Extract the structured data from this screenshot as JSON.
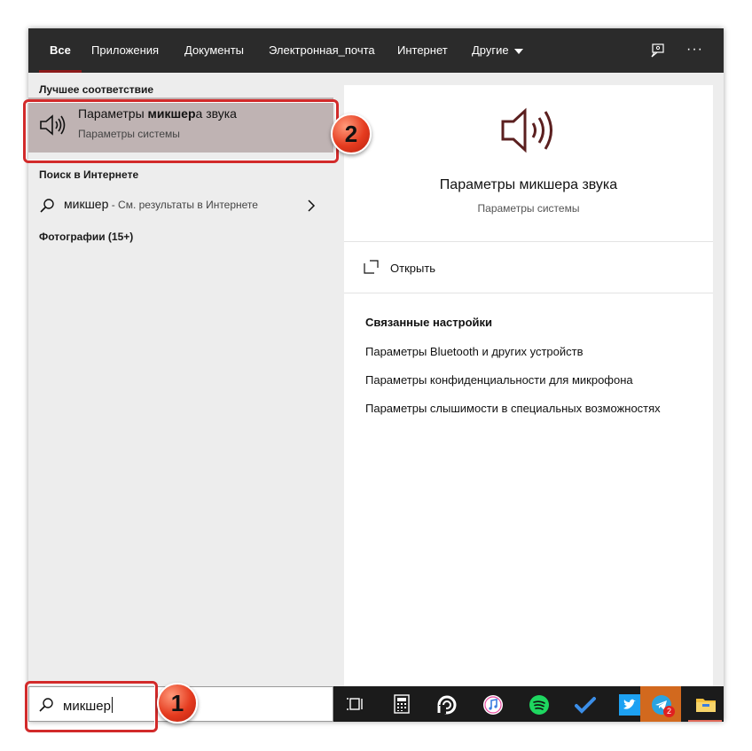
{
  "tabs": [
    {
      "label": "Все",
      "active": true
    },
    {
      "label": "Приложения"
    },
    {
      "label": "Документы"
    },
    {
      "label": "Электронная_почта"
    },
    {
      "label": "Интернет"
    },
    {
      "label": "Другие"
    }
  ],
  "top_icons": [
    "feedback-icon",
    "more-options-icon"
  ],
  "top_more": "···",
  "left": {
    "best_match_heading": "Лучшее соответствие",
    "best_match": {
      "title_prefix": "Параметры ",
      "title_bold": "микшер",
      "title_suffix": "а звука",
      "subtitle": "Параметры системы",
      "icon": "speaker-icon"
    },
    "web_heading": "Поиск в Интернете",
    "web_query": "микшер",
    "web_hint": " - См. результаты в Интернете",
    "photos_heading": "Фотографии (15+)"
  },
  "preview": {
    "icon": "speaker-icon",
    "title": "Параметры микшера звука",
    "subtitle": "Параметры системы",
    "open_label": "Открыть",
    "related_heading": "Связанные настройки",
    "related_links": [
      "Параметры Bluetooth и других устройств",
      "Параметры конфиденциальности для микрофона",
      "Параметры слышимости в специальных возможностях"
    ]
  },
  "search": {
    "value": "микшер",
    "icon": "search-icon"
  },
  "taskbar_apps": [
    "task-view-icon",
    "calculator-icon",
    "cortana-icon",
    "itunes-icon",
    "spotify-icon",
    "todo-icon",
    "twitter-icon",
    "telegram-icon",
    "file-explorer-icon"
  ],
  "telegram_badge": "2",
  "annotations": {
    "badge1": "1",
    "badge2": "2"
  },
  "colors": {
    "accent": "#8b1a1a",
    "highlight": "#bfb3b3",
    "annotation": "#d22a2a",
    "icon": "#5b1f1f"
  }
}
